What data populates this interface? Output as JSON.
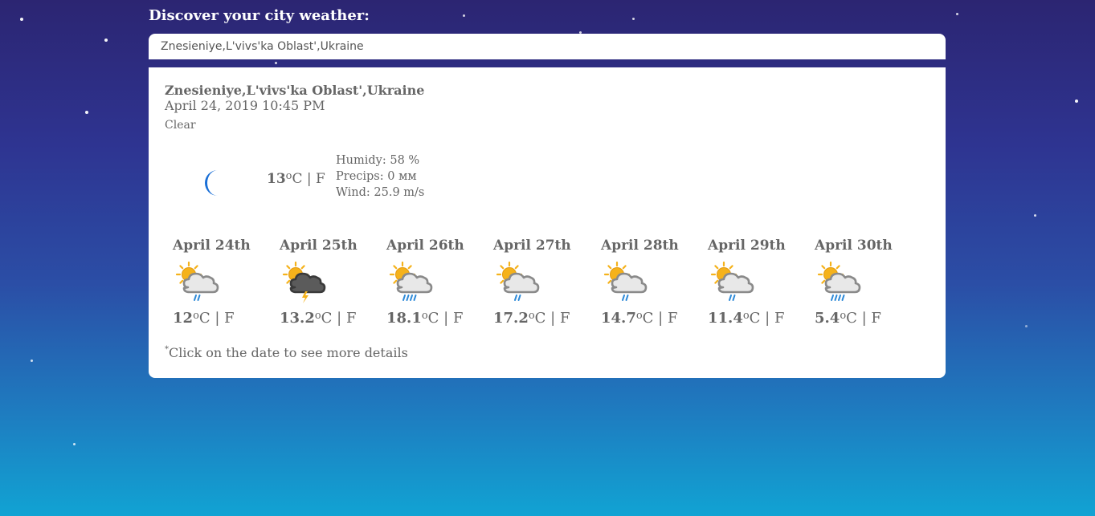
{
  "heading": "Discover your city weather:",
  "search": {
    "value": "Znesieniye,L'vivs'ka Oblast',Ukraine",
    "placeholder": ""
  },
  "current": {
    "city": "Znesieniye,L'vivs'ka Oblast',Ukraine",
    "datetime": "April 24, 2019 10:45 PM",
    "condition": "Clear",
    "icon": "moon-icon",
    "temp": "13",
    "unit_c": "o",
    "unit_rest": "C | F",
    "humidity": "Humidy: 58 %",
    "precips": "Precips: 0 мм",
    "wind": "Wind: 25.9 m/s"
  },
  "forecast": [
    {
      "date": "April 24th",
      "temp": "12",
      "icon": "sun-cloud-light-rain-icon"
    },
    {
      "date": "April 25th",
      "temp": "13.2",
      "icon": "sun-storm-cloud-lightning-icon"
    },
    {
      "date": "April 26th",
      "temp": "18.1",
      "icon": "sun-cloud-heavy-rain-icon"
    },
    {
      "date": "April 27th",
      "temp": "17.2",
      "icon": "sun-cloud-light-rain-icon"
    },
    {
      "date": "April 28th",
      "temp": "14.7",
      "icon": "sun-cloud-light-rain-icon"
    },
    {
      "date": "April 29th",
      "temp": "11.4",
      "icon": "sun-cloud-light-rain-icon"
    },
    {
      "date": "April 30th",
      "temp": "5.4",
      "icon": "sun-cloud-heavy-rain-icon"
    }
  ],
  "degree_sup": "o",
  "unit_rest": "C | F",
  "note_star": "*",
  "note": "Click on the date to see more details",
  "colors": {
    "bg_top": "#2c2572",
    "bg_bottom": "#11a3d3",
    "text": "#666666",
    "moon": "#1a6fd6",
    "sun": "#f5b21b",
    "rain": "#2e8ad8",
    "lightning": "#f5b21b"
  }
}
